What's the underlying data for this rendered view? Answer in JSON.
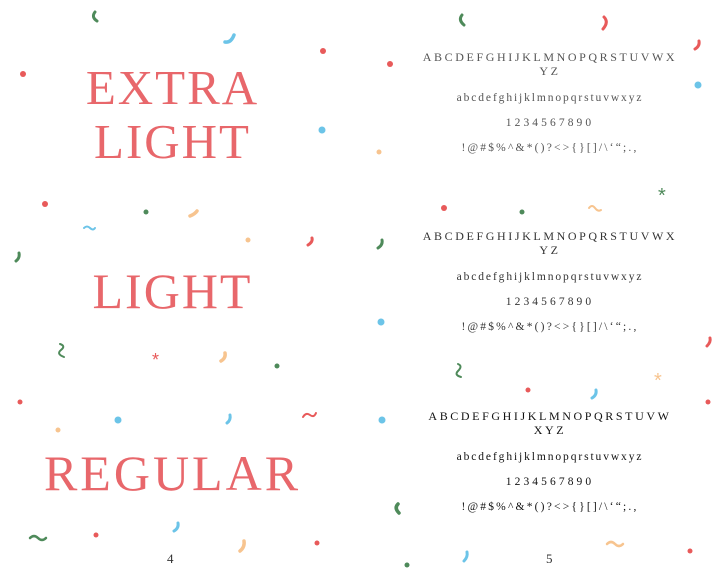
{
  "left_page": {
    "titles": {
      "extra_light_line1": "EXTRA",
      "extra_light_line2": "LIGHT",
      "light": "LIGHT",
      "regular": "REGULAR"
    },
    "page_number": "4"
  },
  "right_page": {
    "page_number": "5",
    "specimens": [
      {
        "uppercase_line1": "ABCDEFGHIJKLMNOPQRSTUVWX",
        "uppercase_line2": "YZ",
        "lowercase": "abcdefghijklmnopqrstuvwxyz",
        "numerals": "1234567890",
        "symbols": "!@#$%^&*()?<>{}[]/\\‘“;.,"
      },
      {
        "uppercase_line1": "ABCDEFGHIJKLMNOPQRSTUVWX",
        "uppercase_line2": "YZ",
        "lowercase": "abcdefghijklmnopqrstuvwxyz",
        "numerals": "1234567890",
        "symbols": "!@#$%^&*()?<>{}[]/\\‘“;.,"
      },
      {
        "uppercase_line1": "ABCDEFGHIJKLMNOPQRSTUVW",
        "uppercase_line2": "XYZ",
        "lowercase": "abcdefghijklmnopqrstuvwxyz",
        "numerals": "1234567890",
        "symbols": "!@#$%^&*()?<>{}[]/\\‘“;.,"
      }
    ]
  },
  "colors": {
    "title": "#e8676b",
    "confetti_red": "#e85a5a",
    "confetti_blue": "#6cc4e8",
    "confetti_green": "#4e8a5a",
    "confetti_peach": "#f7c48f"
  }
}
